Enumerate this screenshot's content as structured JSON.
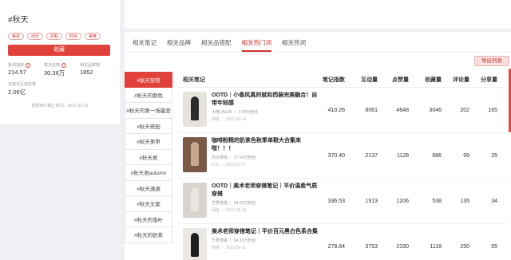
{
  "topic": {
    "title": "#秋天",
    "tags": [
      "美妆",
      "出行",
      "护肤",
      "时尚",
      "美食"
    ],
    "collect_label": "收藏",
    "stats": [
      {
        "label": "热词指数",
        "value": "214.57",
        "has_info": true
      },
      {
        "label": "笔记总数",
        "value": "30.36万",
        "has_info": true
      },
      {
        "label": "相关品牌数",
        "value": "1852",
        "has_info": false
      }
    ],
    "interact_label": "关笔记互动总量",
    "interact_value": "2.06亿",
    "deadline": "数据统计截止时间：2021-09-26"
  },
  "tabs": [
    "相关笔记",
    "相关品牌",
    "相关品搭配",
    "相关热门词",
    "相关热词"
  ],
  "active_tab": 3,
  "export_label": "导出列表",
  "subtopics": [
    "#秋天穿搭",
    "#秋天的颜色",
    "#秋天的第一场露营",
    "#秋天搭配",
    "#秋天美甲",
    "#秋天君",
    "#秋天君autumn",
    "#秋天满满",
    "#秋天文案",
    "#秋天的落叶",
    "#秋天的奶茶"
  ],
  "active_subtopic": 0,
  "table": {
    "headers": [
      "相关笔记",
      "笔记指数",
      "互动量",
      "点赞量",
      "收藏量",
      "评论量",
      "分享量"
    ],
    "rows": [
      {
        "title": "OOTD｜小香风真的就和西装完美融合！自带年轻感",
        "author": "大熊LINLIN ｜ 7.54万粉丝",
        "date": "网络 ｜ 2021-09-14",
        "values": [
          "410.26",
          "8061",
          "4648",
          "3046",
          "202",
          "165"
        ],
        "thumb_color": "#e6e2dc",
        "fig_color": "#2b2b2b"
      },
      {
        "title": "咖啡粉精的奶茶色秋季单鞋大合集来啦！！！",
        "author": "贝仔穿搭 ｜ 17.69万粉丝",
        "date": "KOL ｜ 2021-09-17",
        "values": [
          "370.40",
          "2137",
          "1128",
          "886",
          "99",
          "25"
        ],
        "thumb_color": "#7a5a46",
        "fig_color": "#c9a98d"
      },
      {
        "title": "OOTD｜美术老师穿搭笔记｜平价温柔气质穿搭",
        "author": "艺秀穿搭 ｜ 34.33万粉丝",
        "date": "网络 ｜ 2021-09-15",
        "values": [
          "336.53",
          "1913",
          "1206",
          "538",
          "135",
          "34"
        ],
        "thumb_color": "#d9d4cd",
        "fig_color": "#e9e6e1"
      },
      {
        "title": "美术老师穿搭笔记｜平价百元黑白色系合集",
        "author": "艺秀穿搭 ｜ 34.33万粉丝",
        "date": "网络 ｜ 2021-09-11",
        "values": [
          "278.84",
          "3753",
          "2330",
          "1118",
          "250",
          "55"
        ],
        "thumb_color": "#ebe8e4",
        "fig_color": "#1f1f1f"
      }
    ]
  },
  "colors": {
    "accent": "#e0413b"
  }
}
